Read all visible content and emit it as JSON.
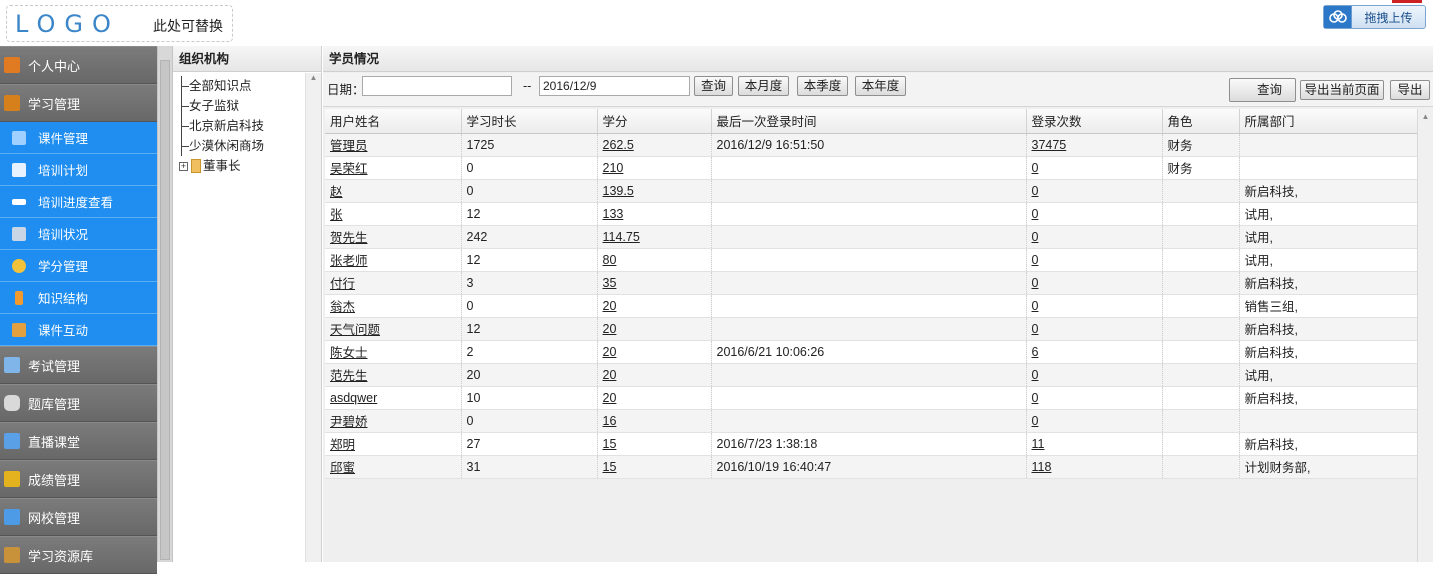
{
  "header": {
    "logo": "LOGO",
    "logo_sub": "此处可替换",
    "upload_label": "拖拽上传"
  },
  "nav": {
    "main_items": [
      {
        "label": "个人中心",
        "color": "#e07b22"
      },
      {
        "label": "学习管理",
        "color": "#d6801c"
      }
    ],
    "sub_items": [
      {
        "label": "课件管理",
        "color": "#9fd0ff"
      },
      {
        "label": "培训计划",
        "color": "#e8f2ff"
      },
      {
        "label": "培训进度查看",
        "color": "#ffffff"
      },
      {
        "label": "培训状况",
        "color": "#c9d6e6"
      },
      {
        "label": "学分管理",
        "color": "#f2c23a"
      },
      {
        "label": "知识结构",
        "color": "#f29a2e"
      },
      {
        "label": "课件互动",
        "color": "#e3a040"
      }
    ],
    "main_items_after": [
      {
        "label": "考试管理",
        "color": "#7fb5e8"
      },
      {
        "label": "题库管理",
        "color": "#d9d9d9"
      },
      {
        "label": "直播课堂",
        "color": "#5aa0e6"
      },
      {
        "label": "成绩管理",
        "color": "#e4b21e"
      },
      {
        "label": "网校管理",
        "color": "#4d9be6"
      },
      {
        "label": "学习资源库",
        "color": "#c8923a"
      }
    ]
  },
  "org": {
    "title": "组织机构",
    "items": [
      "全部知识点",
      "女子监狱",
      "北京新启科技",
      "少漠休闲商场"
    ],
    "folder": "董事长"
  },
  "main": {
    "title": "学员情况",
    "date_label": "日期：",
    "date_from": "",
    "dash": "--",
    "date_to": "2016/12/9",
    "query_label": "查询",
    "month_label": "本月度",
    "quarter_label": "本季度",
    "year_label": "本年度",
    "query2_label": "查询",
    "export_page_label": "导出当前页面",
    "export_label": "导出"
  },
  "grid": {
    "columns": [
      "用户姓名",
      "学习时长",
      "学分",
      "最后一次登录时间",
      "登录次数",
      "角色",
      "所属部门"
    ],
    "rows": [
      [
        "管理员",
        "1725",
        "262.5",
        "2016/12/9 16:51:50",
        "37475",
        "财务",
        ""
      ],
      [
        "吴荣红",
        "0",
        "210",
        "",
        "0",
        "财务",
        ""
      ],
      [
        "赵",
        "0",
        "139.5",
        "",
        "0",
        "",
        "新启科技,"
      ],
      [
        "张",
        "12",
        "133",
        "",
        "0",
        "",
        "试用,"
      ],
      [
        "贺先生",
        "242",
        "114.75",
        "",
        "0",
        "",
        "试用,"
      ],
      [
        "张老师",
        "12",
        "80",
        "",
        "0",
        "",
        "试用,"
      ],
      [
        "付行",
        "3",
        "35",
        "",
        "0",
        "",
        "新启科技,"
      ],
      [
        "翁杰",
        "0",
        "20",
        "",
        "0",
        "",
        "销售三组,"
      ],
      [
        "天气问题",
        "12",
        "20",
        "",
        "0",
        "",
        "新启科技,"
      ],
      [
        "陈女士",
        "2",
        "20",
        "2016/6/21 10:06:26",
        "6",
        "",
        "新启科技,"
      ],
      [
        "范先生",
        "20",
        "20",
        "",
        "0",
        "",
        "试用,"
      ],
      [
        "asdqwer",
        "10",
        "20",
        "",
        "0",
        "",
        "新启科技,"
      ],
      [
        "尹碧娇",
        "0",
        "16",
        "",
        "0",
        "",
        ""
      ],
      [
        "郑明",
        "27",
        "15",
        "2016/7/23 1:38:18",
        "11",
        "",
        "新启科技,"
      ],
      [
        "邱蜜",
        "31",
        "15",
        "2016/10/19 16:40:47",
        "118",
        "",
        "计划财务部,"
      ]
    ]
  }
}
